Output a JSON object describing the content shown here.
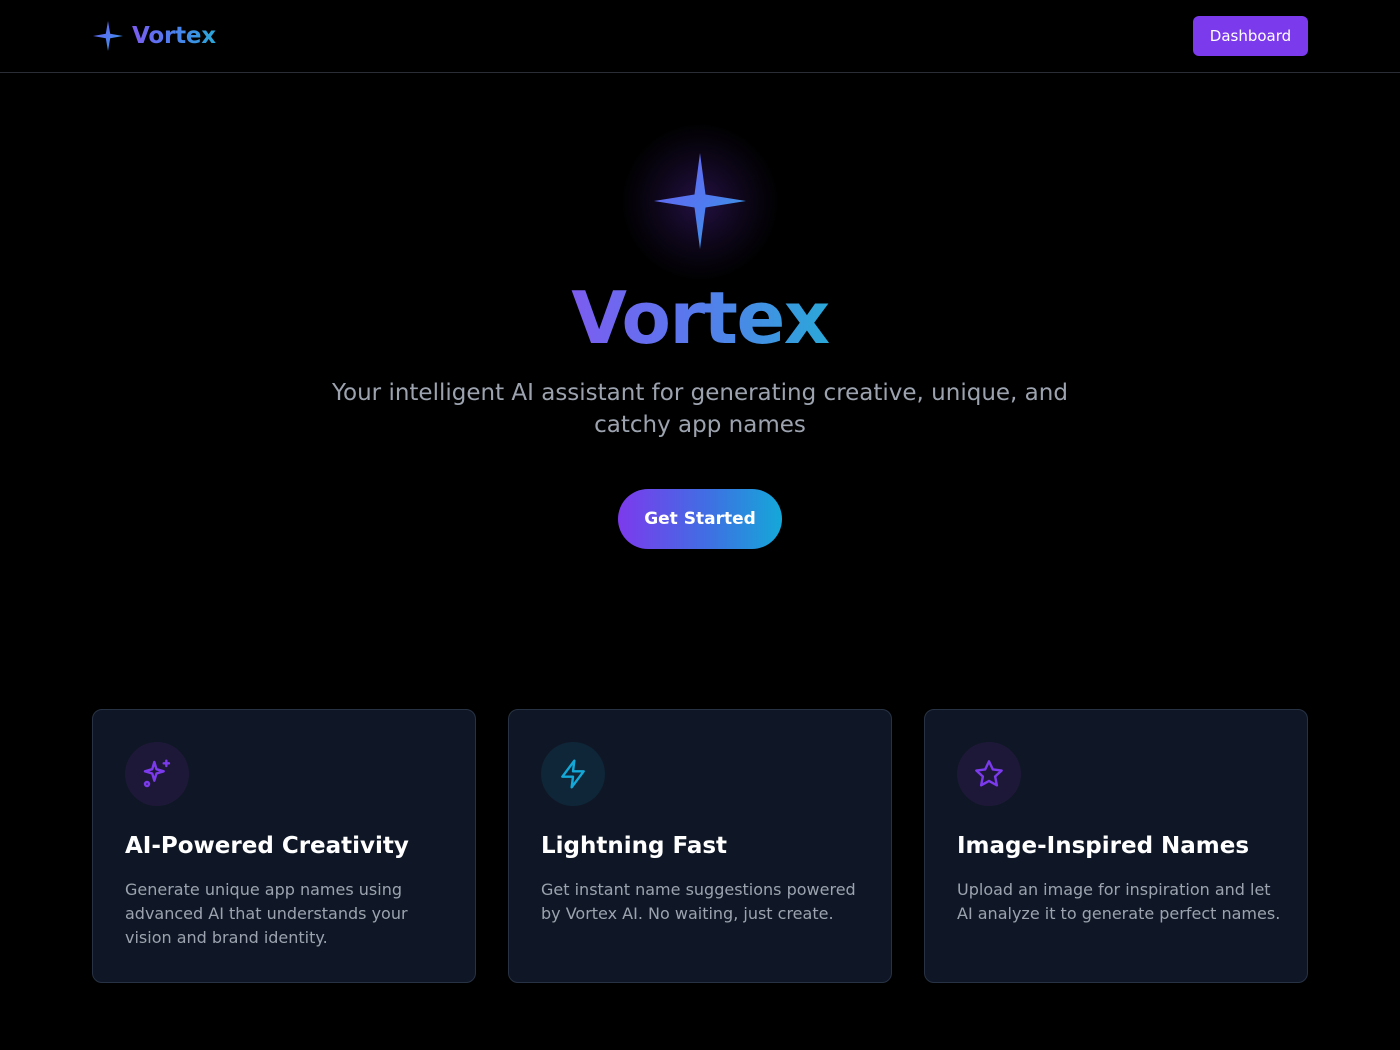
{
  "header": {
    "brand_name": "Vortex",
    "brand_icon": "sparkle-star-icon",
    "dashboard_label": "Dashboard"
  },
  "hero": {
    "icon": "four-point-star-icon",
    "title": "Vortex",
    "subtitle": "Your intelligent AI assistant for generating creative, unique, and catchy app names",
    "cta_label": "Get Started"
  },
  "features": [
    {
      "icon": "sparkles-icon",
      "title": "AI-Powered Creativity",
      "description": "Generate unique app names using advanced AI that understands your vision and brand identity."
    },
    {
      "icon": "lightning-bolt-icon",
      "title": "Lightning Fast",
      "description": "Get instant name suggestions powered by Vortex AI. No waiting, just create."
    },
    {
      "icon": "star-outline-icon",
      "title": "Image-Inspired Names",
      "description": "Upload an image for inspiration and let AI analyze it to generate perfect names."
    }
  ],
  "colors": {
    "background": "#000000",
    "accent_purple": "#7c3aed",
    "accent_blue": "#4f7cf0",
    "accent_cyan": "#14a8d8",
    "card_background": "#0f1726",
    "card_border": "#273244",
    "muted_text": "#9ca3af"
  }
}
